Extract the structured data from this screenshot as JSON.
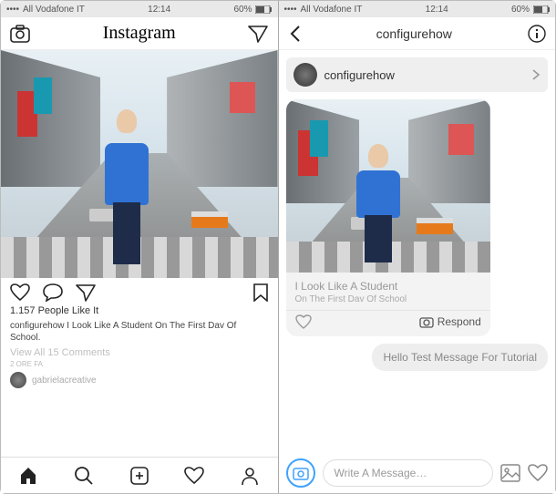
{
  "status": {
    "carrier": "All Vodafone IT",
    "time": "12:14",
    "battery": "60%",
    "batteryIcon": "◉"
  },
  "left": {
    "title": "Instagram",
    "likes": "1.157 People Like It",
    "captionUser": "configurehow",
    "caption": "I Look Like A Student On The First Dav Of School.",
    "viewComments": "View All 15 Comments",
    "timestamp": "2 ORE FA",
    "nextUser": "gabrielacreative"
  },
  "right": {
    "title": "configurehow",
    "recipient": "configurehow",
    "cardTitle": "I Look Like A Student",
    "cardSubtitle": "On The First Dav Of School",
    "respond": "Respond",
    "message": "Hello Test Message For Tutorial",
    "placeholder": "Write A Message…"
  }
}
